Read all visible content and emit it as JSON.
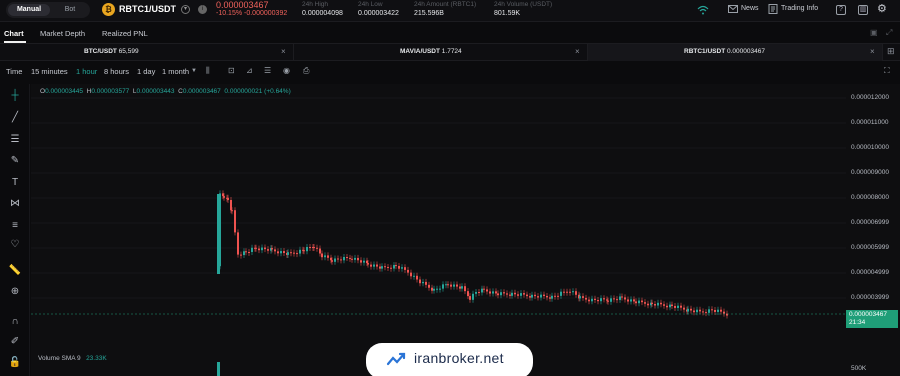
{
  "header": {
    "mode_tabs": [
      "Manual",
      "Bot"
    ],
    "coin_symbol": "₿",
    "pair": "RBTC1/USDT",
    "last_price": "0.000003467",
    "change": "-10.15%  -0.000000392",
    "stats": [
      {
        "label": "24h High",
        "value": "0.000004098"
      },
      {
        "label": "24h Low",
        "value": "0.000003422"
      },
      {
        "label": "24h Amount (RBTC1)",
        "value": "215.596B"
      },
      {
        "label": "24h Volume (USDT)",
        "value": "801.59K"
      }
    ],
    "news": "News",
    "trading_info": "Trading Info"
  },
  "tabs": [
    "Chart",
    "Market Depth",
    "Realized PNL"
  ],
  "chart_tabs": [
    {
      "pair": "BTC/USDT",
      "price": "65,599"
    },
    {
      "pair": "MAVIA/USDT",
      "price": "1.7724"
    },
    {
      "pair": "RBTC1/USDT",
      "price": "0.000003467"
    }
  ],
  "toolbar": {
    "time": "Time",
    "intervals": [
      "15 minutes",
      "1 hour",
      "8 hours",
      "1 day",
      "1 month"
    ],
    "active_interval": "1 hour"
  },
  "ohlc": {
    "o": "0.000003445",
    "h": "0.000003577",
    "l": "0.000003443",
    "c": "0.000003467",
    "chg": "0.000000021 (+0.64%)"
  },
  "volume": {
    "label": "Volume SMA 9",
    "value": "23.33K",
    "axis_label": "500K"
  },
  "price_axis": [
    "0.000012000",
    "0.000011000",
    "0.000010000",
    "0.000009000",
    "0.000008000",
    "0.000006999",
    "0.000005999",
    "0.000004999",
    "0.000003999"
  ],
  "price_tag": {
    "price": "0.000003467",
    "countdown": "21:34"
  },
  "watermark": "iranbroker.net",
  "colors": {
    "up": "#26a69a",
    "down": "#ef5350",
    "tag": "#1f9e78"
  }
}
